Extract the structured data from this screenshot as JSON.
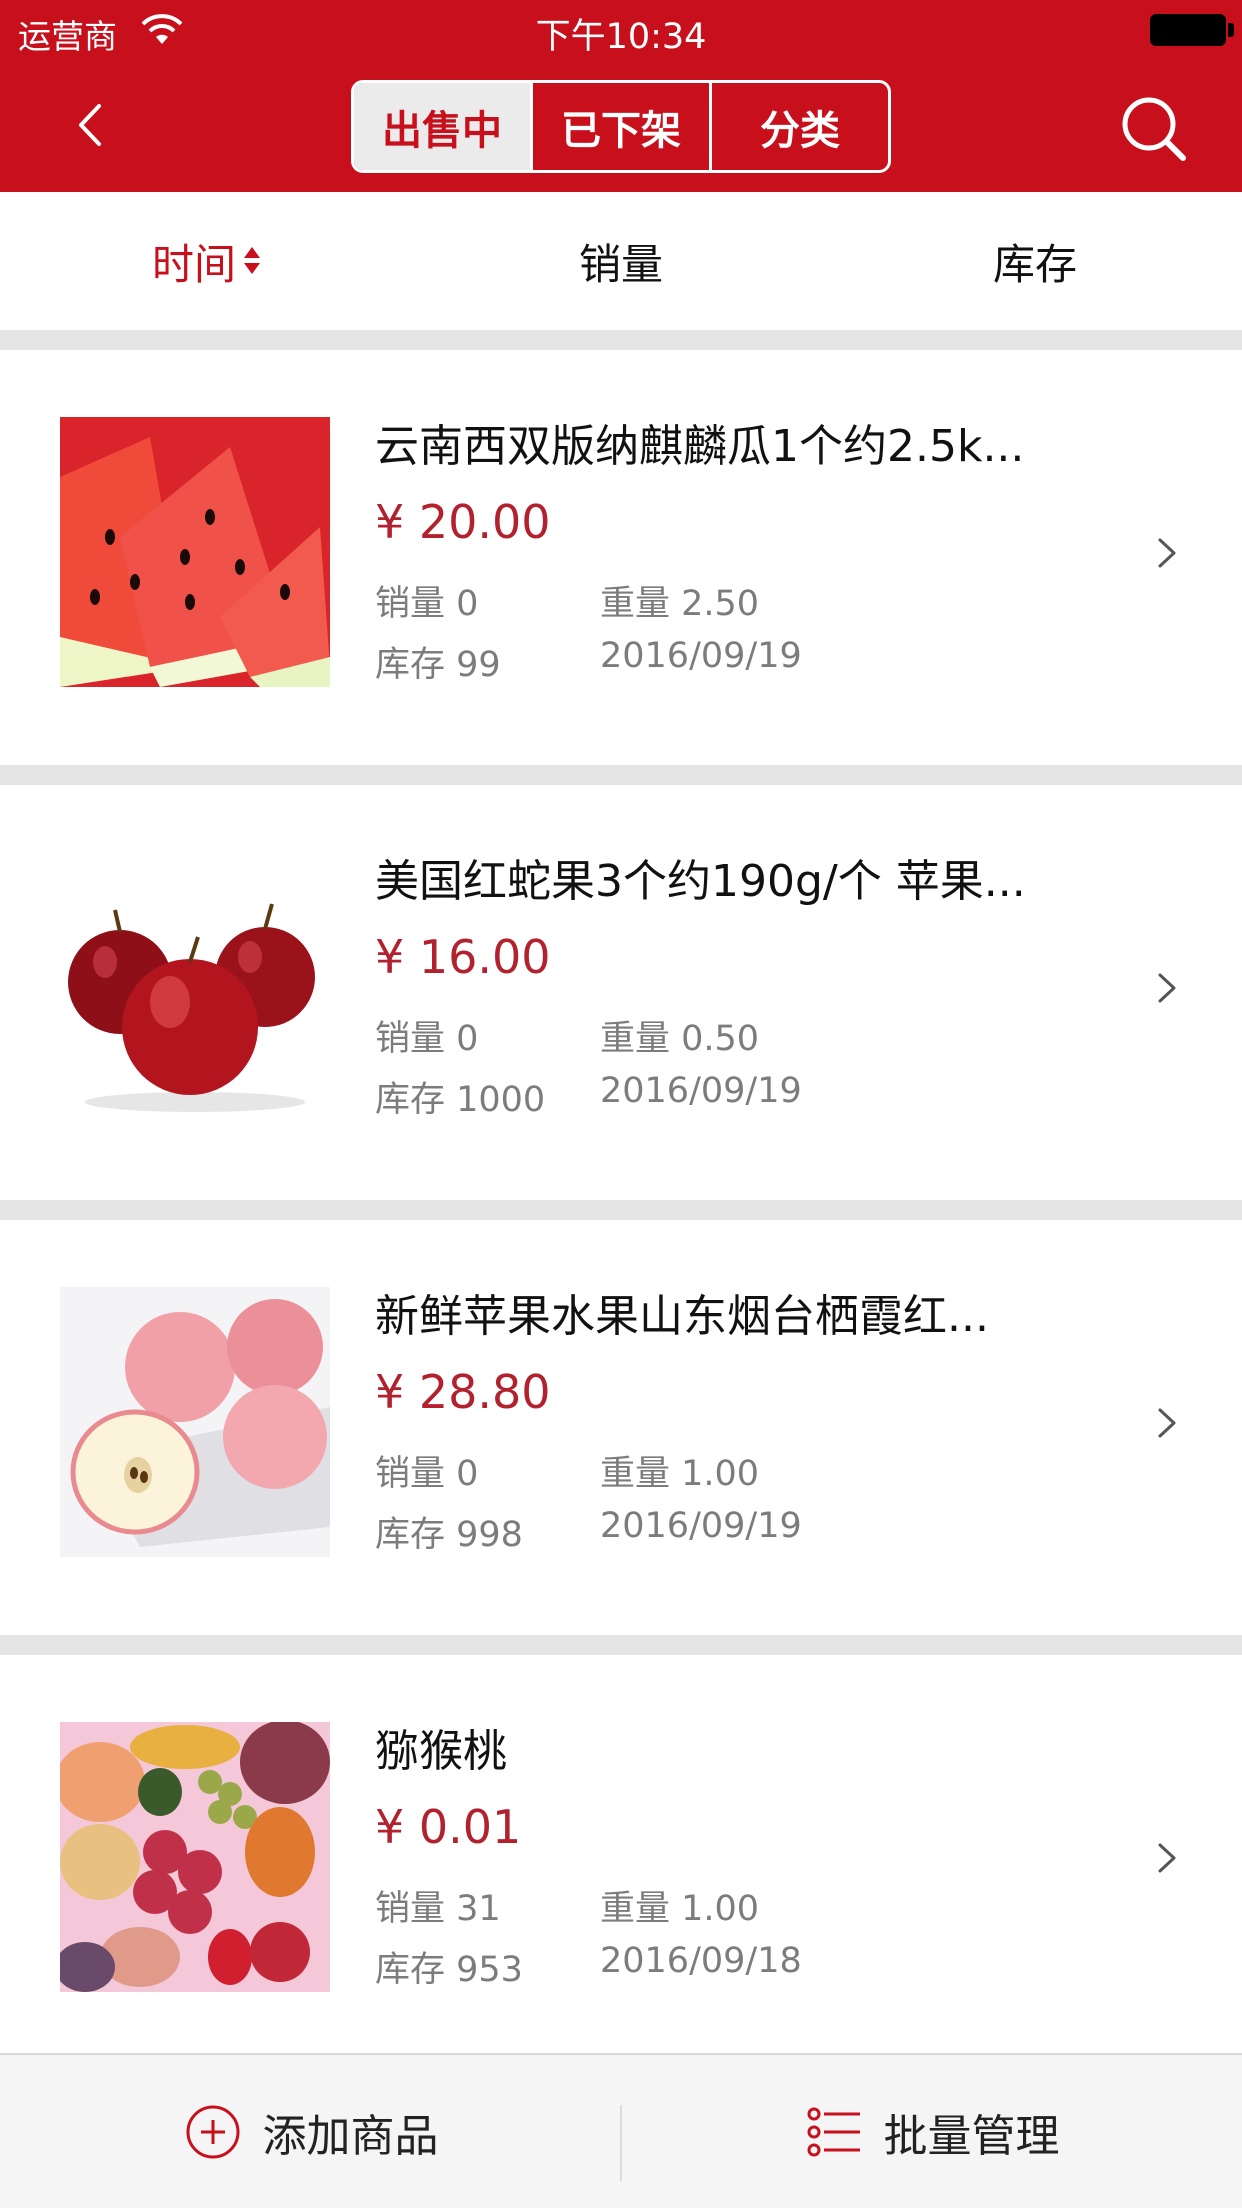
{
  "status_bar": {
    "carrier": "运营商",
    "time": "下午10:34"
  },
  "nav": {
    "segments": [
      {
        "label": "出售中",
        "active": true
      },
      {
        "label": "已下架",
        "active": false
      },
      {
        "label": "分类",
        "active": false
      }
    ],
    "back_icon": "chevron-left-icon",
    "search_icon": "search-icon"
  },
  "sort": {
    "items": [
      {
        "label": "时间",
        "active": true
      },
      {
        "label": "销量",
        "active": false
      },
      {
        "label": "库存",
        "active": false
      }
    ]
  },
  "products": [
    {
      "title": "云南西双版纳麒麟瓜1个约2.5k...",
      "price": "¥ 20.00",
      "sales": "销量 0",
      "weight": "重量 2.50",
      "stock": "库存 99",
      "date": "2016/09/19",
      "image": "watermelon"
    },
    {
      "title": "美国红蛇果3个约190g/个 苹果...",
      "price": "¥ 16.00",
      "sales": "销量 0",
      "weight": "重量 0.50",
      "stock": "库存 1000",
      "date": "2016/09/19",
      "image": "red-apples"
    },
    {
      "title": "新鲜苹果水果山东烟台栖霞红...",
      "price": "¥ 28.80",
      "sales": "销量 0",
      "weight": "重量 1.00",
      "stock": "库存 998",
      "date": "2016/09/19",
      "image": "fuji-apples"
    },
    {
      "title": "猕猴桃",
      "price": "¥ 0.01",
      "sales": "销量 31",
      "weight": "重量 1.00",
      "stock": "库存 953",
      "date": "2016/09/18",
      "image": "mixed-fruits"
    }
  ],
  "bottom": {
    "add_label": "添加商品",
    "batch_label": "批量管理"
  },
  "colors": {
    "brand_red": "#c7101c",
    "price_red": "#b2222e",
    "meta_gray": "#7c7c7c"
  }
}
